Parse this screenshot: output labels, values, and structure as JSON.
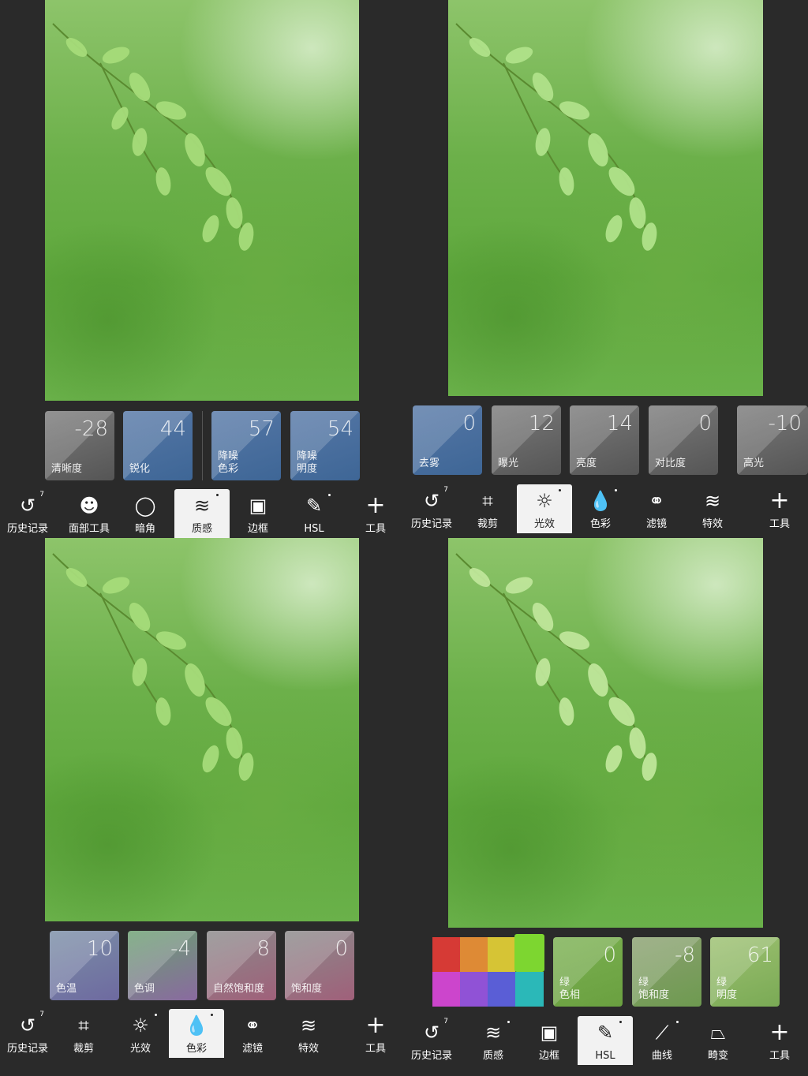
{
  "panels": [
    {
      "cards": [
        {
          "value": "-28",
          "label": "清晰度"
        },
        {
          "value": "44",
          "label": "锐化"
        },
        {
          "value": "57",
          "label": "降噪\n色彩"
        },
        {
          "value": "54",
          "label": "降噪\n明度"
        }
      ],
      "tools": [
        {
          "label": "历史记录",
          "icon": "history-icon",
          "badge": "7"
        },
        {
          "label": "面部工具",
          "icon": "face-icon"
        },
        {
          "label": "暗角",
          "icon": "vignette-icon"
        },
        {
          "label": "质感",
          "icon": "texture-icon",
          "active": true
        },
        {
          "label": "边框",
          "icon": "frame-icon"
        },
        {
          "label": "HSL",
          "icon": "hsl-icon"
        },
        {
          "label": "工具",
          "icon": "plus-icon"
        }
      ]
    },
    {
      "cards": [
        {
          "value": "0",
          "label": "去雾"
        },
        {
          "value": "12",
          "label": "曝光"
        },
        {
          "value": "14",
          "label": "亮度"
        },
        {
          "value": "0",
          "label": "对比度"
        },
        {
          "value": "-10",
          "label": "高光"
        }
      ],
      "tools": [
        {
          "label": "历史记录",
          "icon": "history-icon",
          "badge": "7"
        },
        {
          "label": "裁剪",
          "icon": "crop-icon"
        },
        {
          "label": "光效",
          "icon": "sun-icon",
          "active": true
        },
        {
          "label": "色彩",
          "icon": "color-drops-icon"
        },
        {
          "label": "滤镜",
          "icon": "filter-icon"
        },
        {
          "label": "特效",
          "icon": "effects-icon"
        },
        {
          "label": "工具",
          "icon": "plus-icon"
        }
      ]
    },
    {
      "cards": [
        {
          "value": "10",
          "label": "色温"
        },
        {
          "value": "-4",
          "label": "色调"
        },
        {
          "value": "8",
          "label": "自然饱和度"
        },
        {
          "value": "0",
          "label": "饱和度"
        }
      ],
      "tools": [
        {
          "label": "历史记录",
          "icon": "history-icon",
          "badge": "7"
        },
        {
          "label": "裁剪",
          "icon": "crop-icon"
        },
        {
          "label": "光效",
          "icon": "sun-icon"
        },
        {
          "label": "色彩",
          "icon": "color-drops-icon",
          "active": true
        },
        {
          "label": "滤镜",
          "icon": "filter-icon"
        },
        {
          "label": "特效",
          "icon": "effects-icon"
        },
        {
          "label": "工具",
          "icon": "plus-icon"
        }
      ]
    },
    {
      "swatches": [
        "#d63a35",
        "#de8a35",
        "#d6c435",
        "#7dd630",
        "#cc45cc",
        "#9052d6",
        "#5a5ed6",
        "#2bb8b8"
      ],
      "cards": [
        {
          "value": "0",
          "label": "绿\n色相"
        },
        {
          "value": "-8",
          "label": "绿\n饱和度"
        },
        {
          "value": "61",
          "label": "绿\n明度"
        }
      ],
      "tools": [
        {
          "label": "历史记录",
          "icon": "history-icon",
          "badge": "7"
        },
        {
          "label": "质感",
          "icon": "texture-icon"
        },
        {
          "label": "边框",
          "icon": "frame-icon"
        },
        {
          "label": "HSL",
          "icon": "hsl-icon",
          "active": true
        },
        {
          "label": "曲线",
          "icon": "curve-icon"
        },
        {
          "label": "畸变",
          "icon": "distort-icon"
        },
        {
          "label": "工具",
          "icon": "plus-icon"
        }
      ]
    }
  ]
}
